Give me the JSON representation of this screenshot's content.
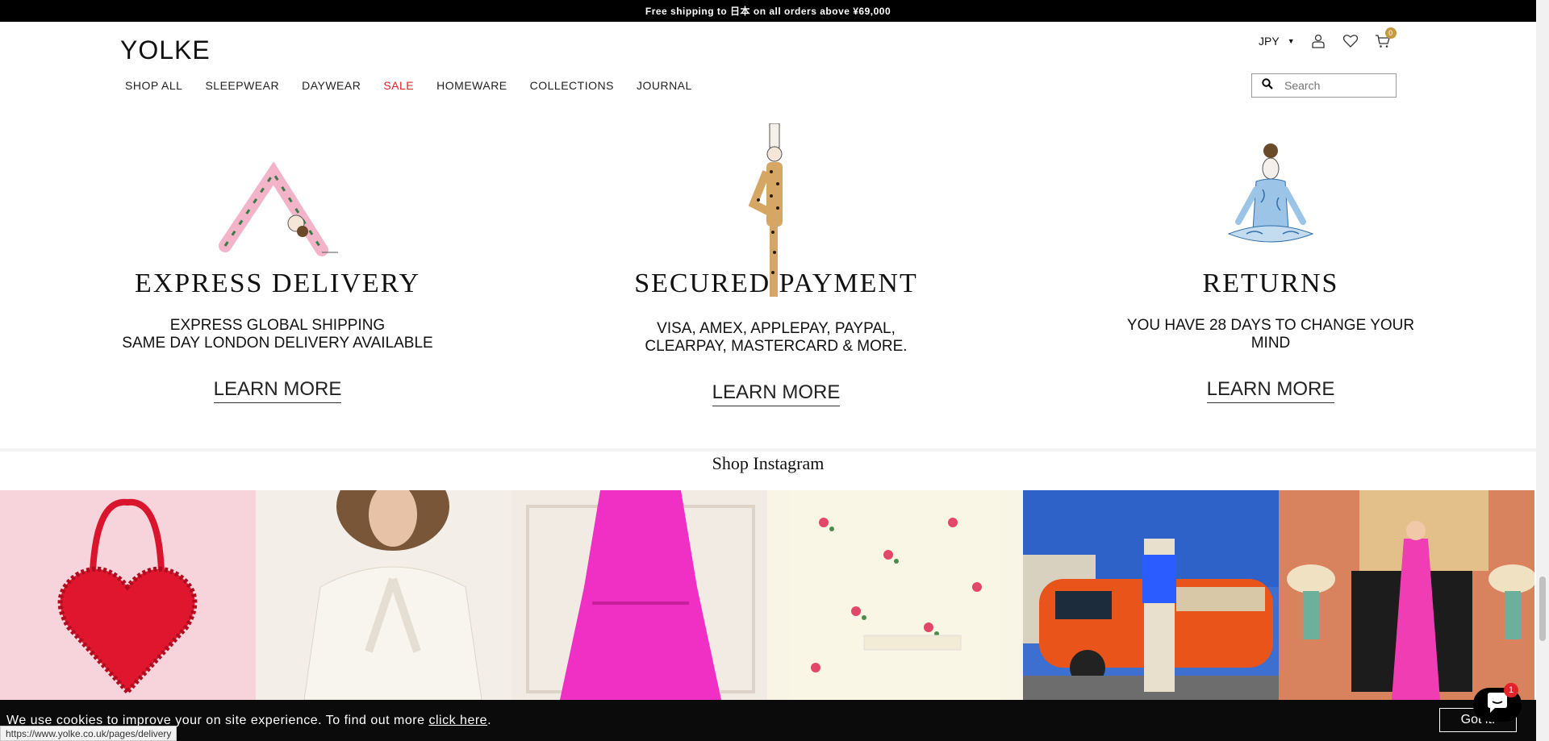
{
  "announcement": "Free shipping to 日本 on all orders above ¥69,000",
  "brand": "YOLKE",
  "nav": [
    "SHOP ALL",
    "SLEEPWEAR",
    "DAYWEAR",
    "SALE",
    "HOMEWARE",
    "COLLECTIONS",
    "JOURNAL"
  ],
  "utility": {
    "currency": "JPY",
    "cart_count": "0"
  },
  "search": {
    "placeholder": "Search"
  },
  "features": [
    {
      "title": "EXPRESS DELIVERY",
      "line1": "EXPRESS GLOBAL SHIPPING",
      "line2": "SAME DAY LONDON DELIVERY AVAILABLE",
      "cta": "LEARN MORE"
    },
    {
      "title": "SECURED PAYMENT",
      "line1": "VISA, AMEX, APPLEPAY, PAYPAL,",
      "line2": "CLEARPAY, MASTERCARD & MORE.",
      "cta": "LEARN MORE"
    },
    {
      "title": "RETURNS",
      "line1": "YOU HAVE 28 DAYS TO CHANGE YOUR",
      "line2": "MIND",
      "cta": "LEARN MORE"
    }
  ],
  "instagram": {
    "title": "Shop Instagram"
  },
  "cookie": {
    "text": "We use cookies to improve your on site experience. To find out more",
    "link": "click here",
    "period": ".",
    "button": "Got it!"
  },
  "status_url": "https://www.yolke.co.uk/pages/delivery",
  "chat_badge": "1",
  "colors": {
    "sale": "#e0242a",
    "badge": "#c89a3f"
  }
}
